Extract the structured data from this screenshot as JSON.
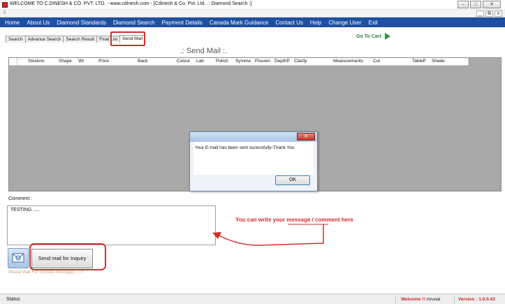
{
  "window": {
    "title": "WELCOME TO C.DINESH & CO. PVT. LTD. - www.cdinesh.com - [Cdinesh & Co. Pvt. Ltd. .: Diamond Search :]",
    "minimize": "–",
    "maximize": "□",
    "close": "✕"
  },
  "mdi": {
    "minimize": "_",
    "restore": "⧉",
    "close": "x"
  },
  "menu": [
    "Home",
    "About Us",
    "Diamond Standards",
    "Diamond Search",
    "Payment Details",
    "Canada Mark Guidance",
    "Contact Us",
    "Help",
    "Change User",
    "Exit"
  ],
  "tabs": [
    "Search",
    "Advance Search",
    "Search Result",
    "Final List",
    "Send Mail"
  ],
  "active_tab": "Send Mail",
  "cart": {
    "label": "Go To Cart"
  },
  "page_title": ".: Send Mail :.",
  "grid": {
    "columns": [
      "Stockno",
      "Shape",
      "Wt",
      "Price",
      "Back",
      "Colour",
      "Lab",
      "Polish",
      "Symme",
      "Flouren",
      "DepthP",
      "Clarity",
      "Measurements",
      "Cut",
      "TableP",
      "Shade"
    ]
  },
  "dialog": {
    "message": "Your E-mail has been sent sucessfully-Thank You",
    "ok": "OK"
  },
  "comment": {
    "label": "Comment :",
    "value": "TESTING ....."
  },
  "annotation": "You can write your message / comment here",
  "send_button": "Send mail for Inquiry",
  "wait_message": "Please Wait For Success Message.......!!",
  "status": {
    "text": "Status",
    "welcome_label": "Welcome !!",
    "user": "mrunal",
    "version": "Version : 1.0.0.43"
  },
  "colors": {
    "menu_bar": "#1e4fa3",
    "highlight": "#d32f2f",
    "cart_green": "#2e7d32",
    "grid_bg": "#a9a9a9"
  }
}
